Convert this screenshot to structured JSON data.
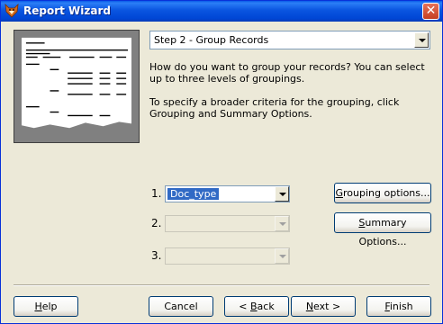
{
  "window": {
    "title": "Report Wizard"
  },
  "step": {
    "selected": "Step 2 - Group Records"
  },
  "description": {
    "paragraph1": "How do you want to group your records? You can select up to three levels of groupings.",
    "paragraph2": "To specify a broader criteria for the grouping, click Grouping and Summary Options."
  },
  "groupings": [
    {
      "number": "1.",
      "value": "Doc_type",
      "enabled": true
    },
    {
      "number": "2.",
      "value": "",
      "enabled": false
    },
    {
      "number": "3.",
      "value": "",
      "enabled": false
    }
  ],
  "buttons": {
    "grouping_options": {
      "label": "Grouping options...",
      "mnemonic": "G"
    },
    "summary_options": {
      "label": "Summary Options...",
      "mnemonic": "S"
    },
    "help": {
      "label": "Help",
      "mnemonic": "H"
    },
    "cancel": {
      "label": "Cancel"
    },
    "back": {
      "label": "< Back",
      "mnemonic": "B"
    },
    "next": {
      "label": "Next >",
      "mnemonic": "N"
    },
    "finish": {
      "label": "Finish",
      "mnemonic": "F"
    }
  },
  "icons": {
    "app": "fox-icon",
    "close": "close-icon",
    "dropdown": "chevron-down-icon"
  }
}
